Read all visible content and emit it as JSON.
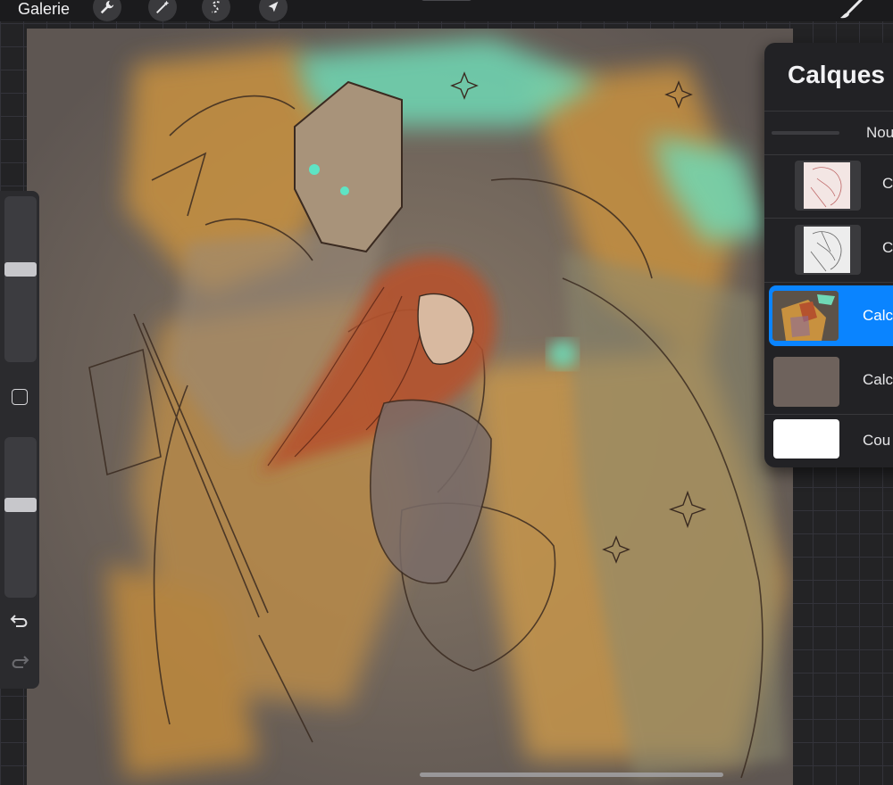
{
  "toolbar": {
    "gallery_label": "Galerie",
    "tools": [
      {
        "name": "wrench-icon",
        "label": "Actions"
      },
      {
        "name": "magic-wand-icon",
        "label": "Adjustments"
      },
      {
        "name": "selection-s-icon",
        "label": "Selection"
      },
      {
        "name": "arrow-cursor-icon",
        "label": "Transform"
      }
    ],
    "right_tool": "brush-icon"
  },
  "sidebar": {
    "brush_size_slider": {
      "level": 0.45
    },
    "opacity_slider": {
      "level": 0.42
    },
    "modify_icon": "square-icon",
    "undo_icon": "undo-arrow-icon",
    "redo_icon": "redo-arrow-icon"
  },
  "layers_panel": {
    "title": "Calques",
    "new_label": "Nou",
    "layers": [
      {
        "name": "C",
        "thumbnail": "red-line-sketch",
        "selected": false
      },
      {
        "name": "C",
        "thumbnail": "gray-line-sketch",
        "selected": false
      },
      {
        "name": "Calc",
        "thumbnail": "color-painting",
        "selected": true
      },
      {
        "name": "Calc",
        "thumbnail": "brown-fill",
        "selected": false
      },
      {
        "name": "Cou",
        "thumbnail": "white-fill",
        "selected": false
      }
    ]
  },
  "colors": {
    "accent": "#0a84ff",
    "canvas_base": "#6e6662",
    "ochre": "#c8913f",
    "teal_glow": "#6fd9b5",
    "hair": "#b5522e",
    "ink": "#3a2a20"
  }
}
